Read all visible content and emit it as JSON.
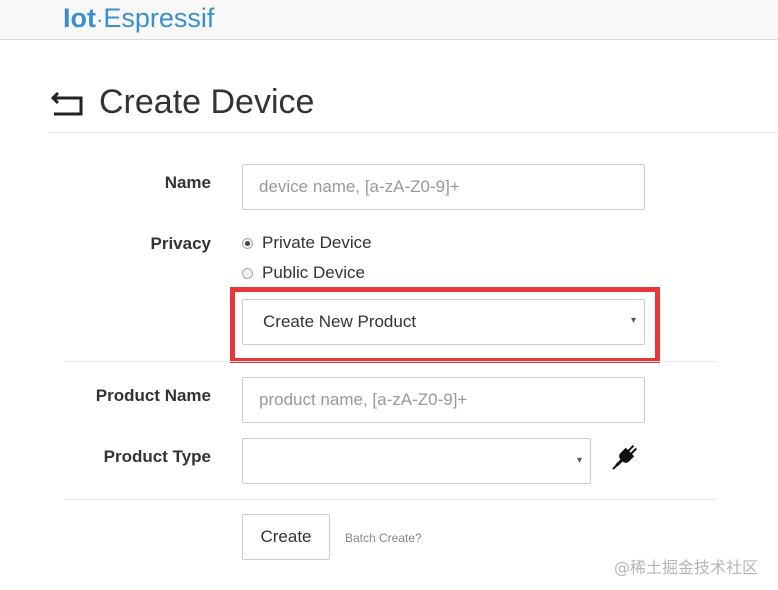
{
  "brand": {
    "part1": "Iot",
    "separator": "·",
    "part2": "Espressif"
  },
  "page": {
    "title": "Create Device"
  },
  "form": {
    "name": {
      "label": "Name",
      "placeholder": "device name, [a-zA-Z0-9]+",
      "value": ""
    },
    "privacy": {
      "label": "Privacy",
      "options": [
        {
          "label": "Private Device",
          "selected": true
        },
        {
          "label": "Public Device",
          "selected": false
        }
      ]
    },
    "product_select": {
      "value": "Create New Product",
      "caret": "▾"
    },
    "product_name": {
      "label": "Product Name",
      "placeholder": "product name, [a-zA-Z0-9]+",
      "value": ""
    },
    "product_type": {
      "label": "Product Type",
      "value": "",
      "caret": "▾"
    },
    "create_button": "Create",
    "batch_link": "Batch Create?"
  },
  "watermark": "@稀土掘金技术社区",
  "colors": {
    "brand": "#3a8fd0",
    "highlight": "#e8353a",
    "topbar": "#f8f8f8"
  },
  "icons": {
    "back": "back-arrow-icon",
    "plug": "plug-icon"
  }
}
